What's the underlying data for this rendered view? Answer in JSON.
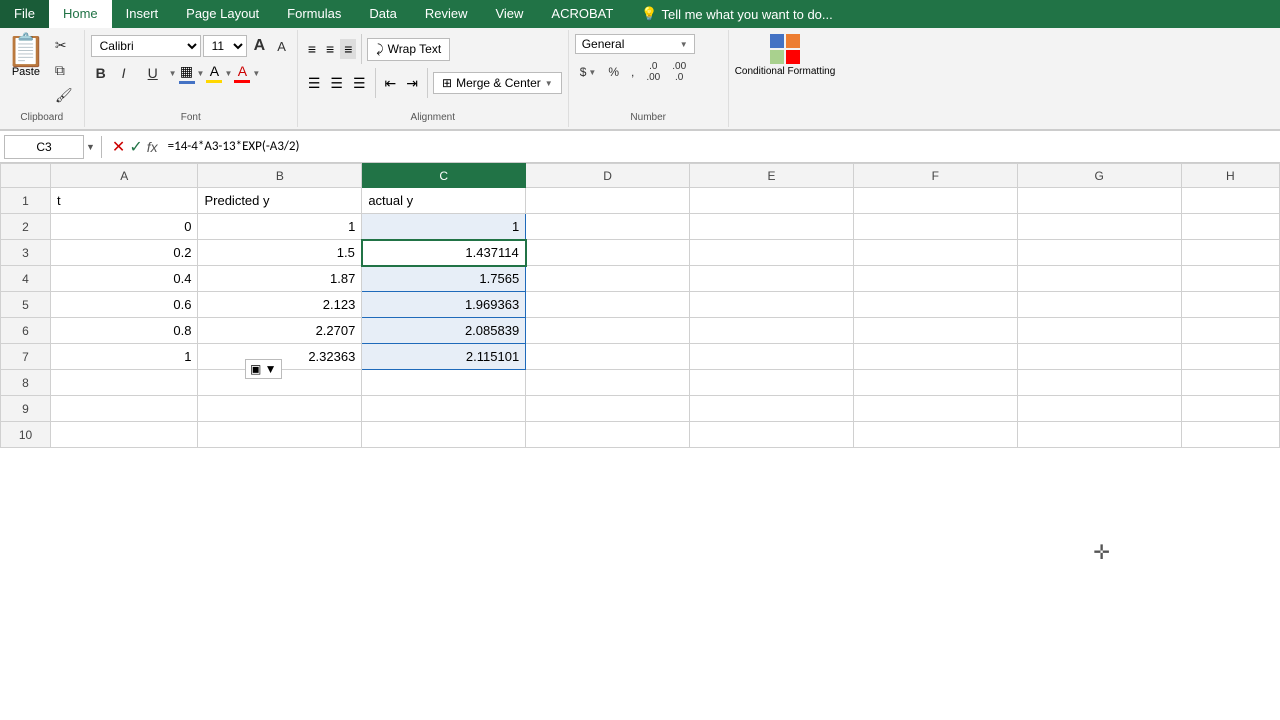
{
  "menu": {
    "items": [
      "File",
      "Home",
      "Insert",
      "Page Layout",
      "Formulas",
      "Data",
      "Review",
      "View",
      "ACROBAT"
    ],
    "active": "Home",
    "search_placeholder": "Tell me what you want to do..."
  },
  "toolbar": {
    "clipboard": {
      "paste_label": "Paste"
    },
    "font": {
      "name": "Calibri",
      "size": "11",
      "bold": "B",
      "italic": "I",
      "underline": "U",
      "increase_font": "A",
      "decrease_font": "A"
    },
    "alignment": {
      "wrap_text": "Wrap Text",
      "merge_center": "Merge & Center"
    },
    "number": {
      "format": "General",
      "dollar": "$",
      "percent": "%",
      "comma": ",",
      "increase_decimal": ".00",
      "decrease_decimal": ".0"
    },
    "conditional_formatting": "Conditional Formatting"
  },
  "formula_bar": {
    "cell_ref": "C3",
    "formula": "=14-4*A3-13*EXP(-A3/2)"
  },
  "columns": [
    "A",
    "B",
    "C",
    "D",
    "E",
    "F",
    "G",
    "H"
  ],
  "rows": [
    {
      "row_num": 1,
      "cells": [
        {
          "col": "A",
          "value": "t",
          "align": "left"
        },
        {
          "col": "B",
          "value": "Predicted y",
          "align": "left"
        },
        {
          "col": "C",
          "value": "actual y",
          "align": "left"
        },
        {
          "col": "D",
          "value": ""
        },
        {
          "col": "E",
          "value": ""
        },
        {
          "col": "F",
          "value": ""
        },
        {
          "col": "G",
          "value": ""
        },
        {
          "col": "H",
          "value": ""
        }
      ]
    },
    {
      "row_num": 2,
      "cells": [
        {
          "col": "A",
          "value": "0",
          "align": "right"
        },
        {
          "col": "B",
          "value": "1",
          "align": "right"
        },
        {
          "col": "C",
          "value": "1",
          "align": "right",
          "selected_range": true
        },
        {
          "col": "D",
          "value": ""
        },
        {
          "col": "E",
          "value": ""
        },
        {
          "col": "F",
          "value": ""
        },
        {
          "col": "G",
          "value": ""
        },
        {
          "col": "H",
          "value": ""
        }
      ]
    },
    {
      "row_num": 3,
      "cells": [
        {
          "col": "A",
          "value": "0.2",
          "align": "right"
        },
        {
          "col": "B",
          "value": "1.5",
          "align": "right"
        },
        {
          "col": "C",
          "value": "1.437114",
          "align": "right",
          "active": true
        },
        {
          "col": "D",
          "value": ""
        },
        {
          "col": "E",
          "value": ""
        },
        {
          "col": "F",
          "value": ""
        },
        {
          "col": "G",
          "value": ""
        },
        {
          "col": "H",
          "value": ""
        }
      ]
    },
    {
      "row_num": 4,
      "cells": [
        {
          "col": "A",
          "value": "0.4",
          "align": "right"
        },
        {
          "col": "B",
          "value": "1.87",
          "align": "right"
        },
        {
          "col": "C",
          "value": "1.7565",
          "align": "right",
          "selected_range": true
        },
        {
          "col": "D",
          "value": ""
        },
        {
          "col": "E",
          "value": ""
        },
        {
          "col": "F",
          "value": ""
        },
        {
          "col": "G",
          "value": ""
        },
        {
          "col": "H",
          "value": ""
        }
      ]
    },
    {
      "row_num": 5,
      "cells": [
        {
          "col": "A",
          "value": "0.6",
          "align": "right"
        },
        {
          "col": "B",
          "value": "2.123",
          "align": "right"
        },
        {
          "col": "C",
          "value": "1.969363",
          "align": "right",
          "selected_range": true
        },
        {
          "col": "D",
          "value": ""
        },
        {
          "col": "E",
          "value": ""
        },
        {
          "col": "F",
          "value": ""
        },
        {
          "col": "G",
          "value": ""
        },
        {
          "col": "H",
          "value": ""
        }
      ]
    },
    {
      "row_num": 6,
      "cells": [
        {
          "col": "A",
          "value": "0.8",
          "align": "right"
        },
        {
          "col": "B",
          "value": "2.2707",
          "align": "right"
        },
        {
          "col": "C",
          "value": "2.085839",
          "align": "right",
          "selected_range": true
        },
        {
          "col": "D",
          "value": ""
        },
        {
          "col": "E",
          "value": ""
        },
        {
          "col": "F",
          "value": ""
        },
        {
          "col": "G",
          "value": ""
        },
        {
          "col": "H",
          "value": ""
        }
      ]
    },
    {
      "row_num": 7,
      "cells": [
        {
          "col": "A",
          "value": "1",
          "align": "right"
        },
        {
          "col": "B",
          "value": "2.32363",
          "align": "right"
        },
        {
          "col": "C",
          "value": "2.115101",
          "align": "right",
          "selected_range": true
        },
        {
          "col": "D",
          "value": ""
        },
        {
          "col": "E",
          "value": ""
        },
        {
          "col": "F",
          "value": ""
        },
        {
          "col": "G",
          "value": ""
        },
        {
          "col": "H",
          "value": ""
        }
      ]
    },
    {
      "row_num": 8,
      "cells": [
        {
          "col": "A",
          "value": ""
        },
        {
          "col": "B",
          "value": ""
        },
        {
          "col": "C",
          "value": ""
        },
        {
          "col": "D",
          "value": ""
        },
        {
          "col": "E",
          "value": ""
        },
        {
          "col": "F",
          "value": ""
        },
        {
          "col": "G",
          "value": ""
        },
        {
          "col": "H",
          "value": ""
        }
      ]
    },
    {
      "row_num": 9,
      "cells": [
        {
          "col": "A",
          "value": ""
        },
        {
          "col": "B",
          "value": ""
        },
        {
          "col": "C",
          "value": ""
        },
        {
          "col": "D",
          "value": ""
        },
        {
          "col": "E",
          "value": ""
        },
        {
          "col": "F",
          "value": ""
        },
        {
          "col": "G",
          "value": ""
        },
        {
          "col": "H",
          "value": ""
        }
      ]
    },
    {
      "row_num": 10,
      "cells": [
        {
          "col": "A",
          "value": ""
        },
        {
          "col": "B",
          "value": ""
        },
        {
          "col": "C",
          "value": ""
        },
        {
          "col": "D",
          "value": ""
        },
        {
          "col": "E",
          "value": ""
        },
        {
          "col": "F",
          "value": ""
        },
        {
          "col": "G",
          "value": ""
        },
        {
          "col": "H",
          "value": ""
        }
      ]
    }
  ],
  "groups": {
    "clipboard_label": "Clipboard",
    "font_label": "Font",
    "alignment_label": "Alignment",
    "number_label": "Number"
  }
}
